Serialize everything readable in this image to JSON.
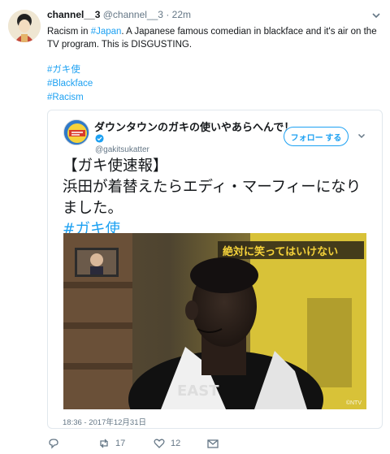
{
  "tweet": {
    "name": "channel__3",
    "handle": "@channel__3",
    "separator": "·",
    "time": "22m",
    "text_before": "Racism in ",
    "text_link": "#Japan",
    "text_after": ". A Japanese famous comedian in blackface and it's air on the TV program. This is DISGUSTING.",
    "hashtags": [
      "#ガキ使",
      "#Blackface",
      "#Racism"
    ]
  },
  "quoted": {
    "name": "ダウンタウンのガキの使いやあらへんで！",
    "handle": "@gakitsukatter",
    "follow_label": "フォロー する",
    "line1": "【ガキ使速報】",
    "line2": "浜田が着替えたらエディ・マーフィーになり",
    "line3": "ました。",
    "hashtag": "#ガキ使",
    "date": "18:36 - 2017年12月31日",
    "media_caption": "©NTV"
  },
  "actions": {
    "retweets": "17",
    "likes": "12"
  },
  "colors": {
    "link": "#1da1f2",
    "muted": "#657786",
    "text": "#14171a"
  }
}
